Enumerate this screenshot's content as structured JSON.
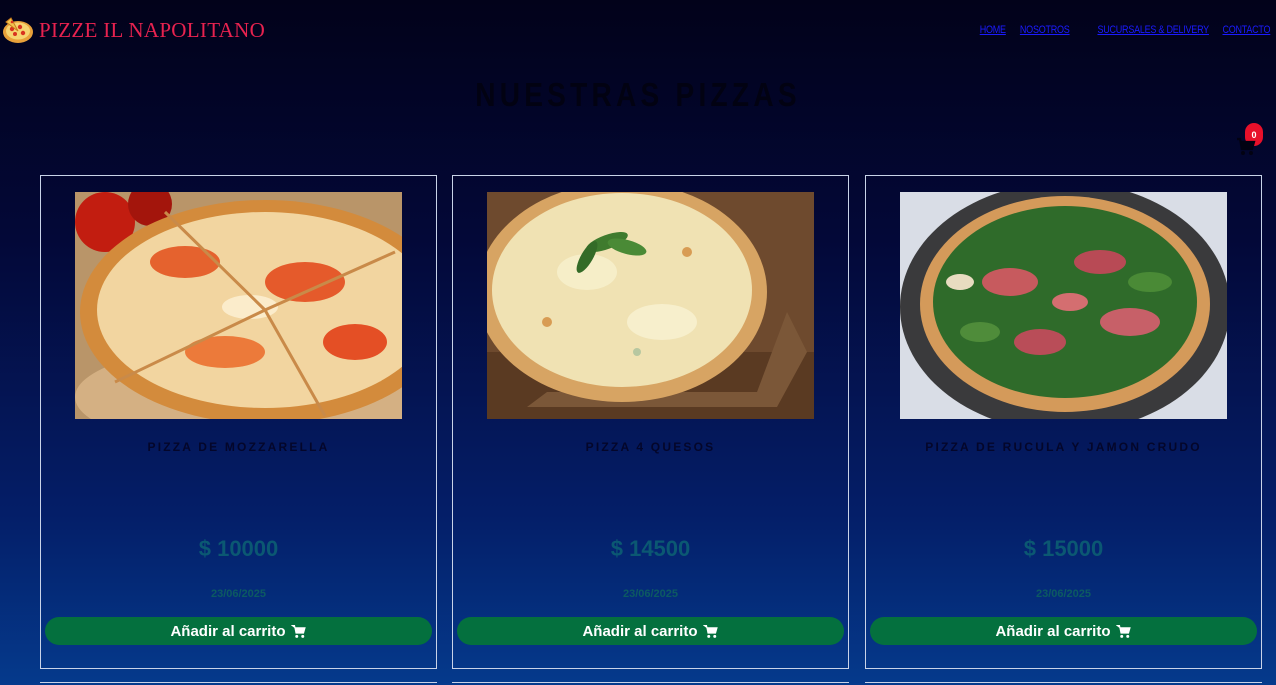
{
  "brand": {
    "name": "PIZZE IL NAPOLITANO",
    "logo_icon": "pizza-icon"
  },
  "nav": {
    "links": [
      "HOME",
      "NOSOTROS",
      "SUCURSALES & DELIVERY",
      "CONTACTO"
    ],
    "link_color": "#1b1bff"
  },
  "page": {
    "title": "NUESTRAS PIZZAS"
  },
  "cart": {
    "icon": "shopping-cart-icon",
    "count": "0",
    "badge_color": "#e8102a"
  },
  "products": [
    {
      "name": "PIZZA DE MOZZARELLA",
      "price": "$ 10000",
      "date": "23/06/2025",
      "button_label": "Añadir al carrito",
      "button_icon": "shopping-cart-icon"
    },
    {
      "name": "PIZZA 4 QUESOS",
      "price": "$ 14500",
      "date": "23/06/2025",
      "button_label": "Añadir al carrito",
      "button_icon": "shopping-cart-icon"
    },
    {
      "name": "PIZZA DE RUCULA Y JAMON CRUDO",
      "price": "$ 15000",
      "date": "23/06/2025",
      "button_label": "Añadir al carrito",
      "button_icon": "shopping-cart-icon"
    }
  ],
  "colors": {
    "brand": "#e7224f",
    "button": "#04703e",
    "price": "#0b5872"
  }
}
